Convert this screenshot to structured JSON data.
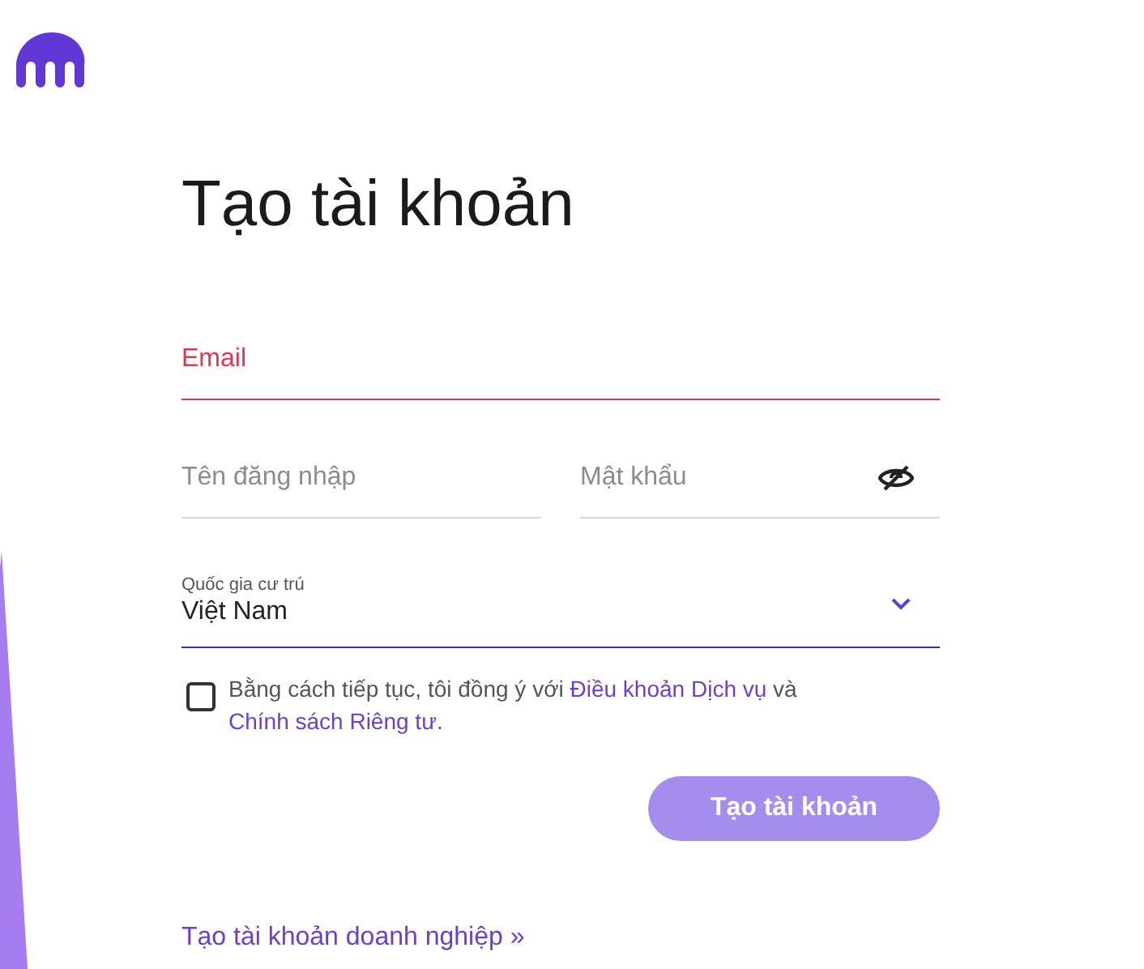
{
  "title": "Tạo tài khoản",
  "email": {
    "placeholder": "Email",
    "invalid": true
  },
  "username": {
    "placeholder": "Tên đăng nhập"
  },
  "password": {
    "placeholder": "Mật khẩu",
    "visible": false
  },
  "country": {
    "label": "Quốc gia cư trú",
    "value": "Việt Nam"
  },
  "terms": {
    "checked": false,
    "parts": [
      {
        "kind": "text",
        "text": "Bằng cách tiếp tục, tôi đồng ý với "
      },
      {
        "kind": "link",
        "text": "Điều khoản Dịch vụ"
      },
      {
        "kind": "text",
        "text": " và "
      },
      {
        "kind": "link",
        "text": "Chính sách Riêng tư"
      },
      {
        "kind": "text",
        "text": "."
      }
    ]
  },
  "submit": {
    "label": "Tạo tài khoản",
    "disabled": true
  },
  "business_link": "Tạo tài khoản doanh nghiệp »"
}
